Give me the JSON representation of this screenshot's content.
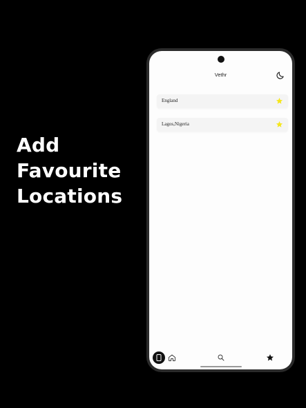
{
  "promo": {
    "line1": "Add",
    "line2": "Favourite",
    "line3": "Locations"
  },
  "app": {
    "title": "Vethr",
    "theme_toggle_icon": "moon-icon"
  },
  "favourites": [
    {
      "name": "England",
      "icon": "star-icon"
    },
    {
      "name": "Lagos,Nigeria",
      "icon": "star-icon"
    }
  ],
  "colors": {
    "star": "#f5e61a",
    "background": "#000000",
    "screen": "#fdfdfd"
  },
  "nav": {
    "items": [
      "phone-icon",
      "home-icon",
      "search-icon",
      "star-icon"
    ]
  }
}
